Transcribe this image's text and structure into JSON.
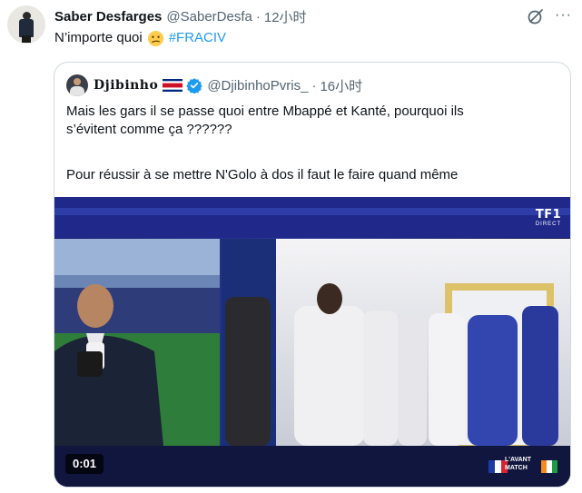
{
  "tweet": {
    "author_name": "Saber Desfarges",
    "handle": "@SaberDesfa",
    "separator": "·",
    "time": "12小时",
    "text": "N’importe quoi",
    "emoji": "confused-face-emoji",
    "hashtag": "#FRACIV",
    "more_label": "···"
  },
  "quote": {
    "author_name": "Djibinho",
    "flag": "costa-rica-flag",
    "verified": true,
    "handle": "@DjibinhoPvris_",
    "separator": "·",
    "time": "16小时",
    "text_line1": "Mais les gars il se passe quoi entre Mbappé et Kanté, pourquoi ils",
    "text_line2": "s’évitent comme ça ??????",
    "text_line3": "Pour réussir à se mettre N'Golo à dos il faut le faire quand même"
  },
  "video": {
    "timestamp": "0:01",
    "channel_logo": "TF1",
    "channel_sub": "DIRECT",
    "show_line1": "L'AVANT",
    "show_line2": "MATCH"
  },
  "colors": {
    "accent": "#1d9bf0",
    "secondary_text": "#536471",
    "border": "#cfd9de"
  }
}
